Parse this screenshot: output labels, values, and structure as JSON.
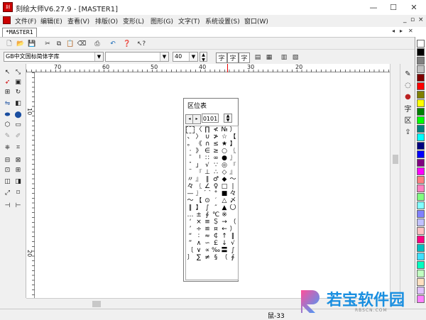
{
  "window": {
    "title": "刻绘大师V6.27.9 - [MASTER1]",
    "controls": {
      "minimize": "—",
      "maximize": "☐",
      "close": "✕"
    }
  },
  "menu": [
    "文件(F)",
    "编辑(E)",
    "查看(V)",
    "排版(O)",
    "变形(L)",
    "图形(G)",
    "文字(T)",
    "系统设置(S)",
    "窗口(W)"
  ],
  "doc_tab": {
    "label": "*MASTER1",
    "nav": [
      "◂",
      "▸",
      "✕"
    ]
  },
  "toolbar": {
    "font_select": "GB中文国标简体字库",
    "style_select": "",
    "size_value": "40",
    "text_buttons": [
      "字",
      "字",
      "字"
    ]
  },
  "rulers": {
    "horizontal": [
      "70",
      "60",
      "50",
      "40",
      "30",
      "20"
    ],
    "vertical": [
      "10",
      "20"
    ]
  },
  "quwei_panel": {
    "title": "区位表",
    "prev": "◂",
    "next": "▸",
    "code_value": "0101",
    "grid_cells": [
      "",
      "、",
      "。",
      "·",
      "ˉ",
      "ˇ",
      "¨",
      "〃",
      "々",
      "—",
      "～",
      "‖",
      "…",
      "‘",
      "’",
      "“",
      "”",
      "〔",
      "〕",
      "〈",
      "〉",
      "《",
      "》",
      "「",
      "」",
      "『",
      "』",
      "〖",
      "〗",
      "【",
      "】",
      "±",
      "×",
      "÷",
      "∶",
      "∧",
      "∨",
      "∑",
      "∏",
      "∪",
      "∩",
      "∈",
      "∷",
      "√",
      "⊥",
      "∥",
      "∠",
      "⌒",
      "⊙",
      "∫",
      "∮",
      "≡",
      "≌",
      "≈",
      "∽",
      "∝",
      "≠",
      "≮",
      "≯",
      "≤",
      "≥",
      "∞",
      "∵",
      "∴",
      "♂",
      "♀",
      "°",
      "′",
      "″",
      "℃",
      "＄",
      "¤",
      "￠",
      "￡",
      "‰",
      "§",
      "№",
      "☆",
      "★",
      "○",
      "●",
      "◎",
      "◇",
      "◆",
      "□",
      "■",
      "△",
      "▲",
      "※",
      "→",
      "←",
      "↑",
      "↓",
      "〓",
      "（",
      "）",
      "【",
      "】",
      "〖",
      "〗",
      "『",
      "』",
      "～",
      "∣",
      "々",
      "〆",
      "〇",
      "",
      "（",
      "）",
      "‖",
      "√",
      "∫",
      "∮"
    ]
  },
  "status": {
    "readout": "鼠-33"
  },
  "palette": [
    "#ffffff",
    "#000000",
    "#808080",
    "#c0c0c0",
    "#800000",
    "#ff0000",
    "#808000",
    "#ffff00",
    "#008000",
    "#00ff00",
    "#008080",
    "#00ffff",
    "#000080",
    "#0000ff",
    "#800080",
    "#ff00ff",
    "#ff8080",
    "#ff80c0",
    "#80ff80",
    "#80ffff",
    "#8080ff",
    "#c0c0ff",
    "#ffc0c0",
    "#ff0080",
    "#00c0c0",
    "#40e0ff",
    "#00ffc0",
    "#c0ffc0",
    "#ffe0c0",
    "#e0c0ff",
    "#ff80ff"
  ],
  "watermark": {
    "brand": "若宝软件园",
    "url": "RBSCN.COM"
  },
  "icons": {
    "top_toolbar": [
      "new-file-icon",
      "open-icon",
      "save-icon",
      "cut-icon",
      "copy-icon",
      "paste-icon",
      "delete-icon",
      "print-icon",
      "undo-icon",
      "help-icon",
      "whats-this-icon"
    ],
    "left_tools": [
      "pointer-icon",
      "node-edit-icon",
      "arrow-tool-icon",
      "image-tool-icon",
      "scale-icon",
      "rotate-icon",
      "mirror-icon",
      "fill-icon",
      "ellipse-icon",
      "circle-icon",
      "polygon-icon",
      "text-box-icon",
      "pen-icon",
      "brush-icon",
      "stamp-icon",
      "weld-icon",
      "grid-icon",
      "align-icon",
      "split-icon",
      "join-icon",
      "layer-icon",
      "group-icon",
      "measure-icon",
      "node-icon",
      "crop-icon",
      "expand-icon"
    ],
    "right_dock": [
      "text-edit-icon",
      "arc-text-icon",
      "color-icon",
      "char-icon",
      "area-icon",
      "export-icon"
    ]
  }
}
